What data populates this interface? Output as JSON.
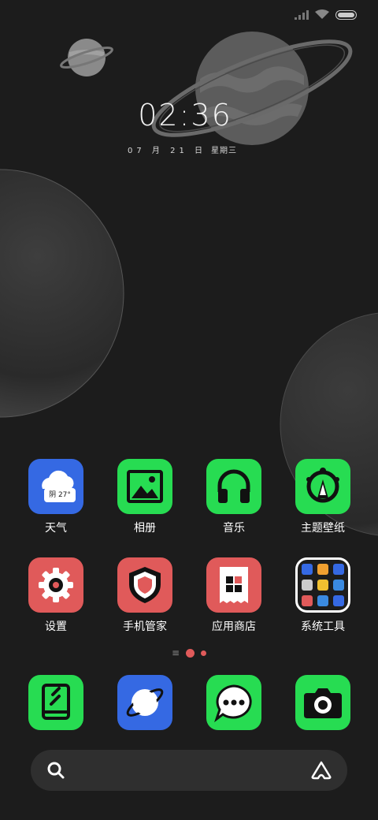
{
  "lockscreen": {
    "time": "02:36",
    "date": "07 月 21 日",
    "weekday": "星期三"
  },
  "status": {
    "signal_icon": "signal-icon",
    "wifi_icon": "wifi-icon",
    "battery_icon": "battery-icon"
  },
  "apps": [
    {
      "label": "天气",
      "icon": "weather-icon",
      "color": "#3569e3",
      "badge": "阴 27°"
    },
    {
      "label": "相册",
      "icon": "gallery-icon",
      "color": "#27dc52"
    },
    {
      "label": "音乐",
      "icon": "headphones-icon",
      "color": "#27dc52"
    },
    {
      "label": "主题壁纸",
      "icon": "theme-icon",
      "color": "#27dc52"
    },
    {
      "label": "设置",
      "icon": "gear-icon",
      "color": "#e05a5a"
    },
    {
      "label": "手机管家",
      "icon": "shield-icon",
      "color": "#e05a5a"
    },
    {
      "label": "应用商店",
      "icon": "store-icon",
      "color": "#e05a5a"
    },
    {
      "label": "系统工具",
      "icon": "folder-icon",
      "color": "#1c1c1c"
    }
  ],
  "dock": [
    {
      "icon": "notes-icon",
      "color": "#27dc52"
    },
    {
      "icon": "browser-icon",
      "color": "#3569e3"
    },
    {
      "icon": "messages-icon",
      "color": "#27dc52"
    },
    {
      "icon": "camera-icon",
      "color": "#27dc52"
    }
  ],
  "search": {
    "search_icon": "search-icon",
    "assistant_icon": "assistant-icon"
  }
}
